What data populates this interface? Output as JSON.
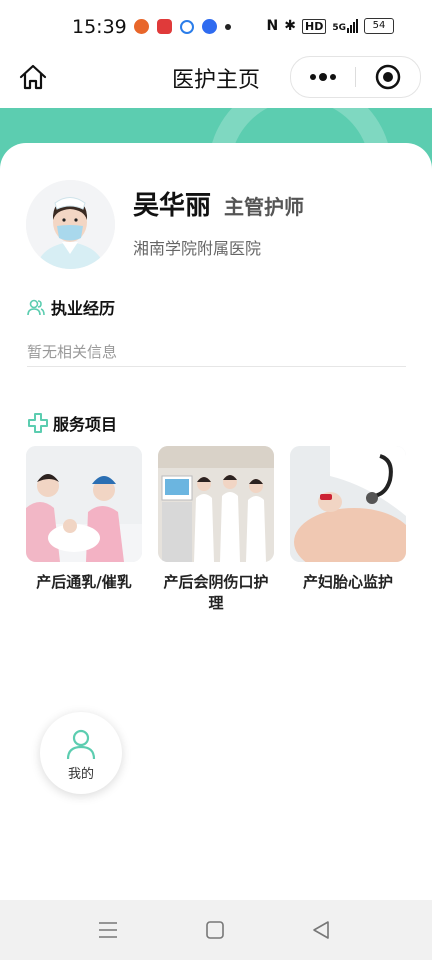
{
  "status": {
    "time": "15:39",
    "battery": "54",
    "net": "5G",
    "hd": "HD",
    "nfc": "N",
    "bluetooth": "✱"
  },
  "header": {
    "title": "医护主页"
  },
  "profile": {
    "name": "吴华丽",
    "title": "主管护师",
    "hospital": "湘南学院附属医院"
  },
  "experience": {
    "heading": "执业经历",
    "placeholder": "暂无相关信息"
  },
  "services": {
    "heading": "服务项目",
    "items": [
      {
        "label": "产后通乳/催乳"
      },
      {
        "label": "产后会阴伤口护理"
      },
      {
        "label": "产妇胎心监护"
      }
    ]
  },
  "floating": {
    "mine_label": "我的"
  },
  "colors": {
    "accent": "#5ccdb0",
    "capsule_border": "#e4e4e4"
  },
  "icons": {
    "home": "home-icon",
    "more": "more-icon",
    "target": "target-icon",
    "experience": "users-icon",
    "services": "medical-cross-icon",
    "mine": "person-icon"
  }
}
